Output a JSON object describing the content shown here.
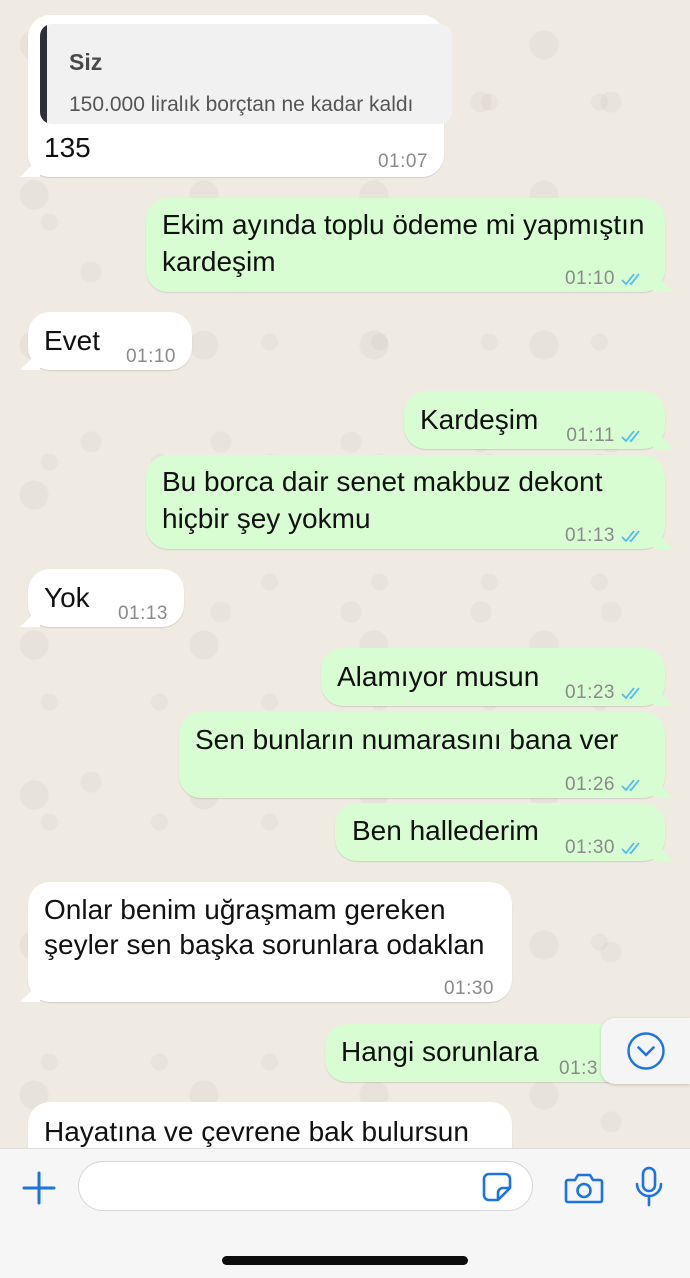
{
  "colors": {
    "incoming_bubble": "#ffffff",
    "outgoing_bubble": "#d9fdd3",
    "read_ticks": "#53bdeb",
    "accent": "#1a73e8",
    "chat_background": "#efeae2"
  },
  "messages": [
    {
      "direction": "in",
      "quoted": {
        "sender": "Siz",
        "text": "150.000 liralık borçtan ne kadar kaldı"
      },
      "text": [
        "135"
      ],
      "time": "01:07"
    },
    {
      "direction": "out",
      "text": [
        "Ekim ayında toplu ödeme mi yapmıştın",
        "kardeşim"
      ],
      "time": "01:10",
      "status": "read"
    },
    {
      "direction": "in",
      "text": [
        "Evet"
      ],
      "time": "01:10"
    },
    {
      "direction": "out",
      "text": [
        "Kardeşim"
      ],
      "time": "01:11",
      "status": "read"
    },
    {
      "direction": "out",
      "text": [
        "Bu borca dair senet makbuz dekont",
        "hiçbir şey yokmu"
      ],
      "time": "01:13",
      "status": "read"
    },
    {
      "direction": "in",
      "text": [
        "Yok"
      ],
      "time": "01:13"
    },
    {
      "direction": "out",
      "text": [
        "Alamıyor musun"
      ],
      "time": "01:23",
      "status": "read"
    },
    {
      "direction": "out",
      "text": [
        "Sen bunların numarasını bana ver"
      ],
      "time": "01:26",
      "status": "read"
    },
    {
      "direction": "out",
      "text": [
        "Ben hallederim"
      ],
      "time": "01:30",
      "status": "read"
    },
    {
      "direction": "in",
      "text": [
        "Onlar benim uğraşmam gereken",
        "şeyler sen başka sorunlara odaklan"
      ],
      "time": "01:30"
    },
    {
      "direction": "out",
      "text": [
        "Hangi sorunlara"
      ],
      "time": "01:3",
      "status": "read"
    },
    {
      "direction": "in",
      "text": [
        "Hayatına ve çevrene bak bulursun"
      ],
      "time": ""
    }
  ],
  "composer": {
    "placeholder": "",
    "icons": {
      "add": "plus-icon",
      "sticker": "sticker-icon",
      "camera": "camera-icon",
      "microphone": "microphone-icon",
      "scroll_down": "chevron-down-circle-icon"
    }
  }
}
